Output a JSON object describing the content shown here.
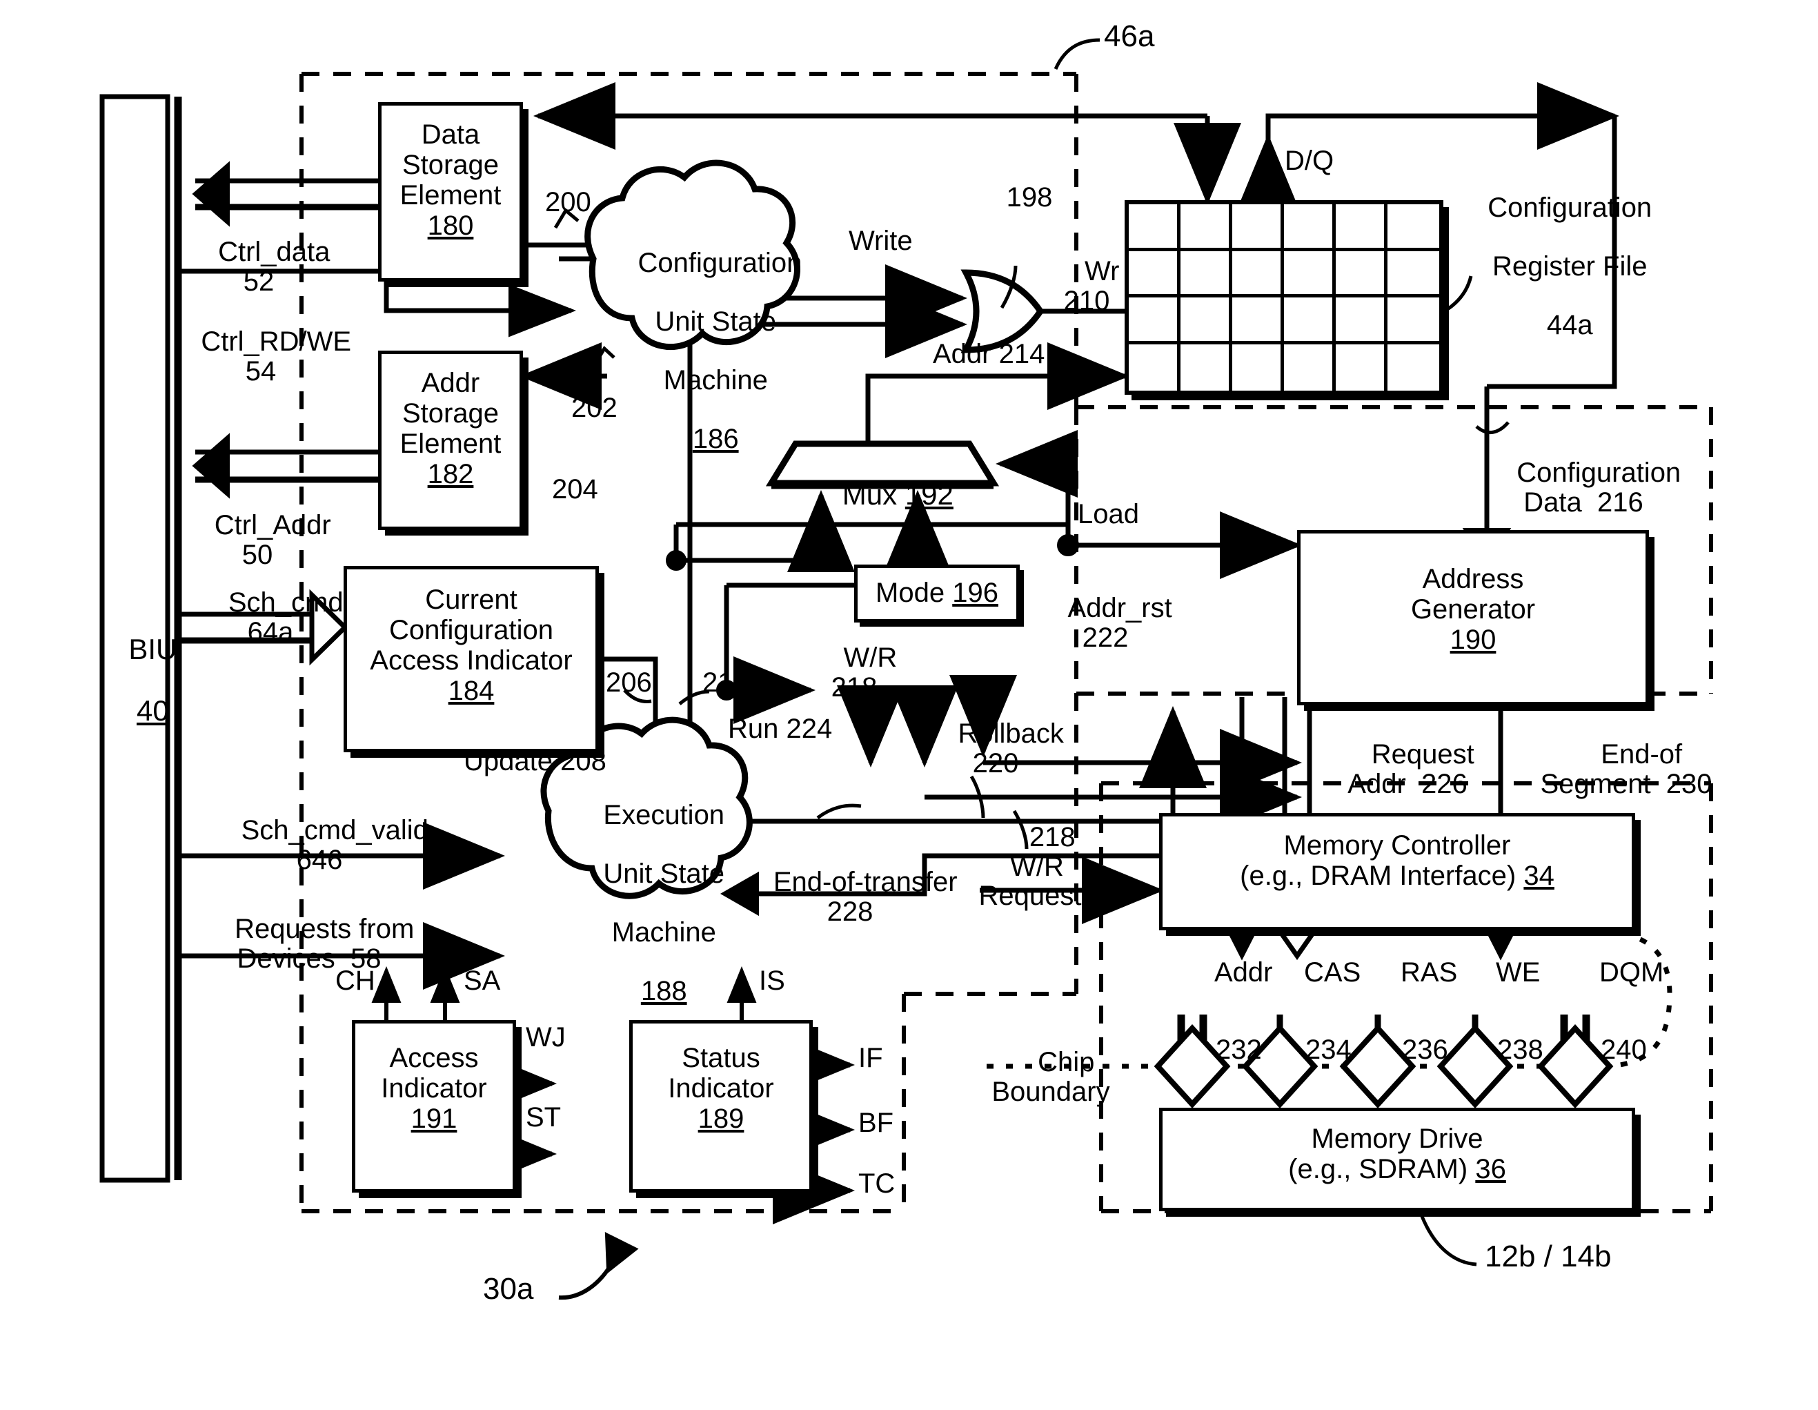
{
  "figure": {
    "type": "patent-block-diagram",
    "background": "#ffffff",
    "ink": "#000000"
  },
  "blocks": {
    "biu": {
      "line1": "BIU",
      "line2": "40"
    },
    "data_storage": {
      "line1": "Data",
      "line2": "Storage",
      "line3": "Element",
      "ref": "180"
    },
    "addr_storage": {
      "line1": "Addr",
      "line2": "Storage",
      "line3": "Element",
      "ref": "182"
    },
    "current_config": {
      "line1": "Current",
      "line2": "Configuration",
      "line3": "Access Indicator",
      "ref": "184"
    },
    "config_unit_sm": {
      "line1": "Configuration",
      "line2": "Unit State",
      "line3": "Machine",
      "ref": "186"
    },
    "execution_unit_sm": {
      "line1": "Execution",
      "line2": "Unit State",
      "line3": "Machine",
      "ref": "188"
    },
    "access_indicator": {
      "line1": "Access",
      "line2": "Indicator",
      "ref": "191"
    },
    "status_indicator": {
      "line1": "Status",
      "line2": "Indicator",
      "ref": "189"
    },
    "mux": {
      "label": "Mux",
      "ref": "192"
    },
    "mode": {
      "label": "Mode",
      "ref": "196"
    },
    "address_generator": {
      "line1": "Address",
      "line2": "Generator",
      "ref": "190"
    },
    "memory_controller": {
      "line1": "Memory Controller",
      "line2": "(e.g., DRAM Interface)",
      "ref": "34"
    },
    "memory_drive": {
      "line1": "Memory Drive",
      "line2": "(e.g., SDRAM)",
      "ref": "36"
    },
    "config_register_file": {
      "line1": "Configuration",
      "line2": "Register File",
      "ref": "44a"
    }
  },
  "signals": {
    "ctrl_data": {
      "name": "Ctrl_data",
      "ref": "52"
    },
    "ctrl_rdwe": {
      "name": "Ctrl_RD/WE",
      "ref": "54"
    },
    "ctrl_addr": {
      "name": "Ctrl_Addr",
      "ref": "50"
    },
    "sch_cmd": {
      "name": "Sch_cmd",
      "ref": "64a"
    },
    "sch_cmd_valid": {
      "name": "Sch_cmd_valid",
      "ref": "646"
    },
    "requests_from_devices": {
      "line1": "Requests from",
      "line2": "Devices  58"
    },
    "write": {
      "name": "Write"
    },
    "wr": {
      "name": "Wr",
      "ref": "210"
    },
    "addr214": {
      "name": "Addr 214"
    },
    "dq": {
      "name": "D/Q"
    },
    "or_gate_ref": "198",
    "ref200": "200",
    "ref202": "202",
    "ref204": "204",
    "ref206": "206",
    "ref212": "212",
    "update": {
      "name": "Update 208"
    },
    "load": {
      "name": "Load"
    },
    "addr_rst": {
      "name": "Addr_rst",
      "ref": "222"
    },
    "wr_slash_r": {
      "name": "W/R",
      "ref": "218"
    },
    "rollback": {
      "name": "Rollback",
      "ref": "220"
    },
    "run": {
      "name": "Run 224"
    },
    "end_of_transfer": {
      "name": "End-of-transfer",
      "ref": "228"
    },
    "wr_requests": {
      "ref": "218",
      "line1": "W/R",
      "line2": "Requests"
    },
    "configuration_data": {
      "line1": "Configuration",
      "line2": "Data  216"
    },
    "request_addr": {
      "line1": "Request",
      "line2": "Addr  226"
    },
    "end_of_segment": {
      "line1": "End-of",
      "line2": "Segment  230"
    },
    "mem_outputs": [
      {
        "name": "Addr",
        "ref": "232"
      },
      {
        "name": "CAS",
        "ref": "234"
      },
      {
        "name": "RAS",
        "ref": "236"
      },
      {
        "name": "WE",
        "ref": "238"
      },
      {
        "name": "DQM",
        "ref": "240"
      }
    ],
    "access_in": [
      "CH",
      "SA"
    ],
    "access_out": [
      "WJ",
      "ST"
    ],
    "status_in": [
      "IS"
    ],
    "status_out": [
      "IF",
      "BF",
      "TC"
    ]
  },
  "callouts": {
    "ref46a": "46a",
    "ref30a": "30a",
    "ref12b14b": "12b / 14b",
    "chip_boundary": {
      "line1": "Chip",
      "line2": "Boundary"
    }
  },
  "grid": {
    "cols": 6,
    "rows": 4
  }
}
